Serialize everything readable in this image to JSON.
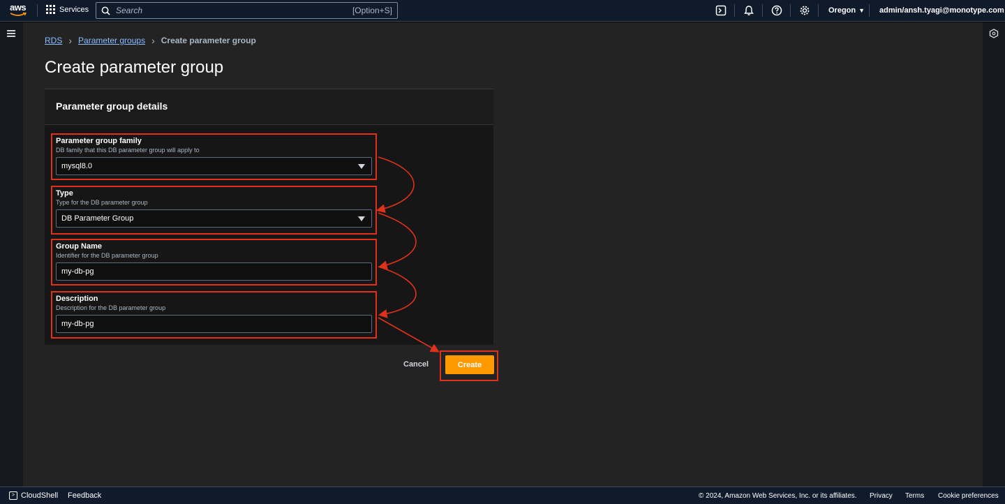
{
  "topnav": {
    "logo": "aws",
    "services_label": "Services",
    "search_placeholder": "Search",
    "search_shortcut": "[Option+S]",
    "region": "Oregon",
    "account": "admin/ansh.tyagi@monotype.com"
  },
  "breadcrumb": {
    "items": [
      "RDS",
      "Parameter groups"
    ],
    "current": "Create parameter group"
  },
  "page_title": "Create parameter group",
  "container": {
    "title": "Parameter group details",
    "fields": [
      {
        "label": "Parameter group family",
        "description": "DB family that this DB parameter group will apply to",
        "value": "mysql8.0",
        "type": "select"
      },
      {
        "label": "Type",
        "description": "Type for the DB parameter group",
        "value": "DB Parameter Group",
        "type": "select"
      },
      {
        "label": "Group Name",
        "description": "Identifier for the DB parameter group",
        "value": "my-db-pg",
        "type": "input"
      },
      {
        "label": "Description",
        "description": "Description for the DB parameter group",
        "value": "my-db-pg",
        "type": "input"
      }
    ]
  },
  "actions": {
    "cancel": "Cancel",
    "create": "Create"
  },
  "footer": {
    "cloudshell": "CloudShell",
    "feedback": "Feedback",
    "copyright": "© 2024, Amazon Web Services, Inc. or its affiliates.",
    "privacy": "Privacy",
    "terms": "Terms",
    "cookies": "Cookie preferences"
  },
  "colors": {
    "accent": "#ff9900",
    "highlight": "#e0311b",
    "link": "#89bdff"
  }
}
